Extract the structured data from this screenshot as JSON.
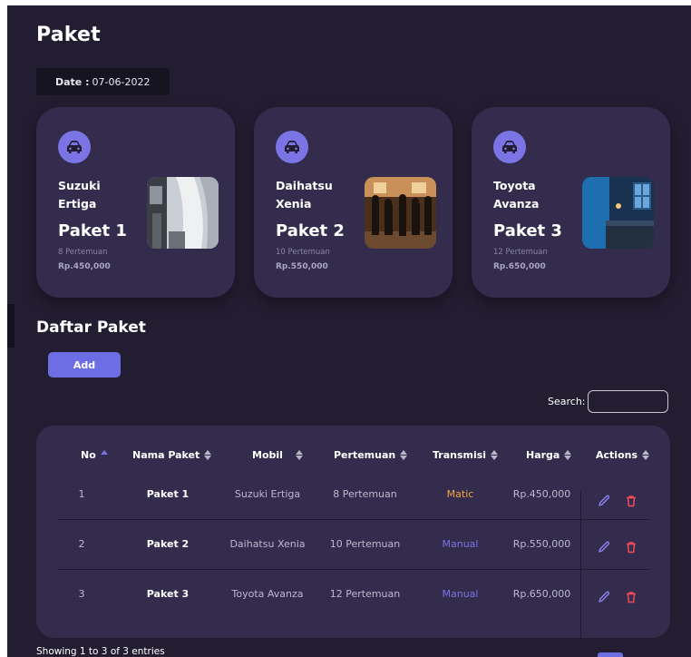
{
  "page": {
    "title": "Paket"
  },
  "date": {
    "label": "Date :",
    "value": "07-06-2022"
  },
  "cards": [
    {
      "car": "Suzuki Ertiga",
      "package": "Paket 1",
      "meetings": "8 Pertemuan",
      "price": "Rp.450,000",
      "icon": "car-icon"
    },
    {
      "car": "Daihatsu Xenia",
      "package": "Paket 2",
      "meetings": "10 Pertemuan",
      "price": "Rp.550,000",
      "icon": "car-icon"
    },
    {
      "car": "Toyota Avanza",
      "package": "Paket 3",
      "meetings": "12 Pertemuan",
      "price": "Rp.650,000",
      "icon": "car-icon"
    }
  ],
  "list": {
    "title": "Daftar Paket",
    "add_label": "Add",
    "search_label": "Search:",
    "search_value": "",
    "columns": [
      "No",
      "Nama Paket",
      "Mobil",
      "Pertemuan",
      "Transmisi",
      "Harga",
      "Actions"
    ],
    "rows": [
      {
        "no": "1",
        "paket": "Paket 1",
        "mobil": "Suzuki Ertiga",
        "pertemuan": "8 Pertemuan",
        "transmisi": "Matic",
        "harga": "Rp.450,000"
      },
      {
        "no": "2",
        "paket": "Paket 2",
        "mobil": "Daihatsu Xenia",
        "pertemuan": "10 Pertemuan",
        "transmisi": "Manual",
        "harga": "Rp.550,000"
      },
      {
        "no": "3",
        "paket": "Paket 3",
        "mobil": "Toyota Avanza",
        "pertemuan": "12 Pertemuan",
        "transmisi": "Manual",
        "harga": "Rp.650,000"
      }
    ],
    "footer": "Showing 1 to 3 of 3 entries"
  },
  "colors": {
    "background": "#221d31",
    "card": "#342c4d",
    "accent": "#6e6ee4",
    "matic": "#f0a742",
    "manual": "#7a74e4",
    "delete": "#f24a57"
  }
}
